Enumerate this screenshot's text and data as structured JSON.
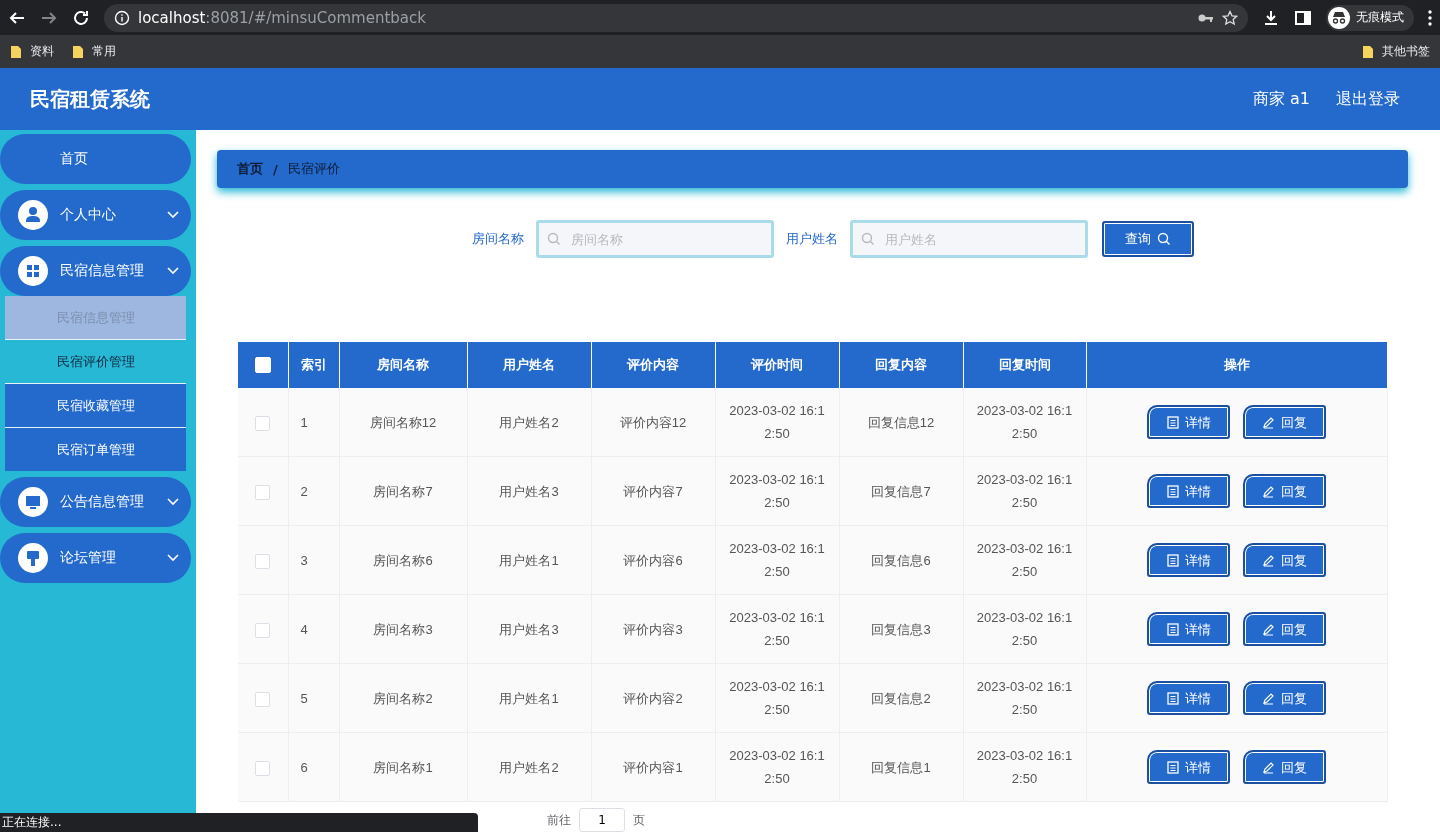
{
  "browser": {
    "url_host": "localhost",
    "url_rest": ":8081/#/minsuCommentback",
    "profile": "无痕模式",
    "bookmarks": [
      "资料",
      "常用"
    ],
    "other_bookmarks": "其他书签",
    "status": "正在连接..."
  },
  "header": {
    "title": "民宿租赁系统",
    "user": "商家 a1",
    "logout": "退出登录"
  },
  "sidebar": {
    "items": [
      {
        "label": "首页"
      },
      {
        "label": "个人中心"
      },
      {
        "label": "民宿信息管理",
        "expanded": true,
        "children": [
          {
            "label": "民宿信息管理",
            "selected": false,
            "hovered": true
          },
          {
            "label": "民宿评价管理",
            "selected": true,
            "hovered": false
          },
          {
            "label": "民宿收藏管理",
            "selected": false,
            "hovered": false
          },
          {
            "label": "民宿订单管理",
            "selected": false,
            "hovered": false
          }
        ]
      },
      {
        "label": "公告信息管理"
      },
      {
        "label": "论坛管理"
      }
    ]
  },
  "breadcrumb": {
    "items": [
      "首页",
      "民宿评价"
    ],
    "separator": "/"
  },
  "search": {
    "fields": [
      {
        "label": "房间名称",
        "placeholder": "房间名称"
      },
      {
        "label": "用户姓名",
        "placeholder": "用户姓名"
      }
    ],
    "button": "查询"
  },
  "table": {
    "select_all_checked": false,
    "columns": [
      "索引",
      "房间名称",
      "用户姓名",
      "评价内容",
      "评价时间",
      "回复内容",
      "回复时间",
      "操作"
    ],
    "rows": [
      {
        "checked": false,
        "cells": [
          "1",
          "房间名称12",
          "用户姓名2",
          "评价内容12",
          "2023-03-02 16:12:50",
          "回复信息12",
          "2023-03-02 16:12:50"
        ],
        "actions": [
          "详情",
          "回复"
        ]
      },
      {
        "checked": false,
        "cells": [
          "2",
          "房间名称7",
          "用户姓名3",
          "评价内容7",
          "2023-03-02 16:12:50",
          "回复信息7",
          "2023-03-02 16:12:50"
        ],
        "actions": [
          "详情",
          "回复"
        ]
      },
      {
        "checked": false,
        "cells": [
          "3",
          "房间名称6",
          "用户姓名1",
          "评价内容6",
          "2023-03-02 16:12:50",
          "回复信息6",
          "2023-03-02 16:12:50"
        ],
        "actions": [
          "详情",
          "回复"
        ]
      },
      {
        "checked": false,
        "cells": [
          "4",
          "房间名称3",
          "用户姓名3",
          "评价内容3",
          "2023-03-02 16:12:50",
          "回复信息3",
          "2023-03-02 16:12:50"
        ],
        "actions": [
          "详情",
          "回复"
        ]
      },
      {
        "checked": false,
        "cells": [
          "5",
          "房间名称2",
          "用户姓名1",
          "评价内容2",
          "2023-03-02 16:12:50",
          "回复信息2",
          "2023-03-02 16:12:50"
        ],
        "actions": [
          "详情",
          "回复"
        ]
      },
      {
        "checked": false,
        "cells": [
          "6",
          "房间名称1",
          "用户姓名2",
          "评价内容1",
          "2023-03-02 16:12:50",
          "回复信息1",
          "2023-03-02 16:12:50"
        ],
        "actions": [
          "详情",
          "回复"
        ]
      }
    ]
  },
  "pagination": {
    "goto": "前往",
    "page": "1",
    "unit": "页"
  }
}
